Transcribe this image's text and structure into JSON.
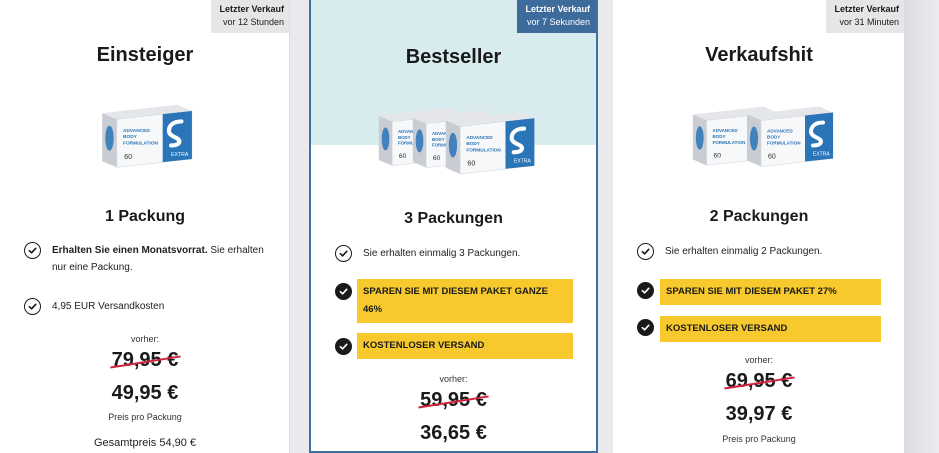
{
  "cards": [
    {
      "badge": {
        "line1": "Letzter Verkauf",
        "line2": "vor 12 Stunden"
      },
      "title": "Einsteiger",
      "quantity": "1 Packung",
      "features": [
        {
          "bold": "Erhalten Sie einen Monatsvorrat.",
          "text": " Sie erhalten nur eine Packung."
        },
        {
          "bold": "",
          "text": "4,95 EUR Versandkosten"
        }
      ],
      "before_label": "vorher:",
      "old_price": "79,95 €",
      "new_price": "49,95 €",
      "per_package": "Preis pro Packung",
      "total": "Gesamtpreis 54,90 €"
    },
    {
      "badge": {
        "line1": "Letzter Verkauf",
        "line2": "vor 7 Sekunden"
      },
      "title": "Bestseller",
      "quantity": "3 Packungen",
      "features": [
        {
          "text": "Sie erhalten einmalig 3 Packungen."
        }
      ],
      "highlights": [
        "SPAREN SIE MIT DIESEM PAKET GANZE 46%",
        "KOSTENLOSER VERSAND"
      ],
      "before_label": "vorher:",
      "old_price": "59,95 €",
      "new_price": "36,65 €"
    },
    {
      "badge": {
        "line1": "Letzter Verkauf",
        "line2": "vor 31 Minuten"
      },
      "title": "Verkaufshit",
      "quantity": "2 Packungen",
      "features": [
        {
          "text": "Sie erhalten einmalig 2 Packungen."
        }
      ],
      "highlights": [
        "SPAREN SIE MIT DIESEM PAKET 27%",
        "KOSTENLOSER VERSAND"
      ],
      "before_label": "vorher:",
      "old_price": "69,95 €",
      "new_price": "39,97 €",
      "per_package": "Preis pro Packung"
    }
  ],
  "product": {
    "box_text": "ADVANCED BODY FORMULATION",
    "count": "60",
    "variant": "EXTRA",
    "brand_color": "#2a74b8"
  },
  "colors": {
    "highlight": "#f7c92c",
    "strike": "#d0223a",
    "featured_border": "#3f6f9f",
    "featured_bg": "#d8ecf0"
  }
}
